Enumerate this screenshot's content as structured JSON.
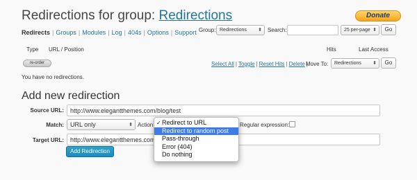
{
  "header": {
    "title_prefix": "Redirections for group: ",
    "group_link": "Redirections",
    "donate_label": "Donate"
  },
  "subnav": {
    "items": [
      {
        "label": "Redirects",
        "current": true
      },
      {
        "label": "Groups",
        "current": false
      },
      {
        "label": "Modules",
        "current": false
      },
      {
        "label": "Log",
        "current": false
      },
      {
        "label": "404s",
        "current": false
      },
      {
        "label": "Options",
        "current": false
      },
      {
        "label": "Support",
        "current": false
      }
    ]
  },
  "filters": {
    "group_label": "Group:",
    "group_value": "Redirections",
    "search_label": "Search:",
    "search_value": "",
    "per_page": "25 per-page",
    "go_label": "Go"
  },
  "table": {
    "columns": [
      "Type",
      "URL / Position",
      "Hits",
      "Last Access"
    ],
    "reorder_label": "re-order",
    "empty_message": "You have no redirections."
  },
  "bulk_actions": {
    "links": [
      "Select All",
      "Toggle",
      "Reset Hits",
      "Delete"
    ],
    "move_label": "Move To:",
    "move_value": "Redirections",
    "go_label": "Go"
  },
  "add_form": {
    "section_title": "Add new redirection",
    "source_label": "Source URL:",
    "source_value": "http://www.elegantthemes.com/blog/test",
    "match_label": "Match:",
    "match_value": "URL only",
    "action_label": "Action:",
    "regex_label": "Regular expression:",
    "target_label": "Target URL:",
    "target_value": "http://www.elegantthemes.com/",
    "submit_label": "Add Redirection"
  },
  "action_dropdown": {
    "options": [
      {
        "label": "Redirect to URL",
        "checked": true,
        "highlighted": false
      },
      {
        "label": "Redirect to random post",
        "checked": false,
        "highlighted": true
      },
      {
        "label": "Pass-through",
        "checked": false,
        "highlighted": false
      },
      {
        "label": "Error (404)",
        "checked": false,
        "highlighted": false
      },
      {
        "label": "Do nothing",
        "checked": false,
        "highlighted": false
      }
    ],
    "check_glyph": "✓"
  },
  "icons": {
    "select_arrow": "updown-arrow-icon",
    "checkmark": "checkmark-icon"
  },
  "colors": {
    "link": "#21759b",
    "primary_button": "#1e8cbe",
    "highlight": "#3d7ce8",
    "donate": "#f7a51c"
  }
}
